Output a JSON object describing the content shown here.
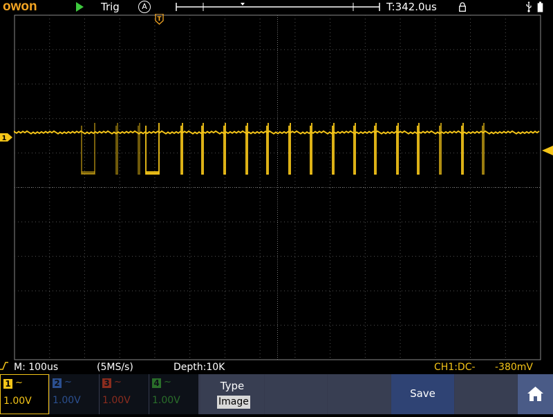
{
  "top_bar": {
    "logo": "owon",
    "run_state_icon": "play-icon",
    "trigger_status": "Trig",
    "trigger_mode_badge": "A",
    "timebase_position": "T:342.0us",
    "icons": [
      "play-icon",
      "auto-trigger-icon",
      "lock-icon",
      "usb-icon",
      "battery-icon"
    ]
  },
  "screen": {
    "trigger_marker": "T",
    "channel_marker": "1"
  },
  "status_bar": {
    "timebase": "M: 100us",
    "sample_rate": "(5MS/s)",
    "depth": "Depth:10K",
    "trigger_channel": "CH1:DC-",
    "trigger_level": "-380mV"
  },
  "channels": [
    {
      "num": "1",
      "coupling": "~",
      "volts": "1.00V",
      "color": "#f5c518",
      "active": true
    },
    {
      "num": "2",
      "coupling": "~",
      "volts": "1.00V",
      "color": "#3a6fd1",
      "active": false
    },
    {
      "num": "3",
      "coupling": "~",
      "volts": "1.00V",
      "color": "#c9402a",
      "active": false
    },
    {
      "num": "4",
      "coupling": "~",
      "volts": "1.00V",
      "color": "#3aa63a",
      "active": false
    }
  ],
  "menu": {
    "type_title": "Type",
    "type_value": "Image",
    "save_label": "Save",
    "home_icon": "home-icon"
  },
  "colors": {
    "trace": "#f5c518",
    "accent": "#f5a623",
    "menu_bg": "#353a4e",
    "save_bg": "#2f4374"
  }
}
